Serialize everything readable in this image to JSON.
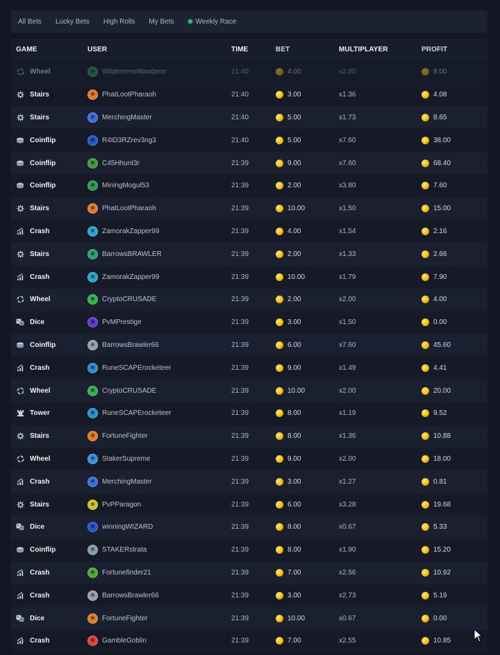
{
  "tabs": [
    {
      "label": "All Bets"
    },
    {
      "label": "Lucky Bets"
    },
    {
      "label": "High Rolls"
    },
    {
      "label": "My Bets"
    },
    {
      "label": "Weekly Race",
      "live": true
    }
  ],
  "columns": {
    "game": "GAME",
    "user": "USER",
    "time": "TIME",
    "bet": "BET",
    "multiplier": "MULTIPLAYER",
    "profit": "PROFIT"
  },
  "colors": {
    "background": "#121723",
    "coin": "#f2b705",
    "live_dot": "#27c270"
  },
  "rows": [
    {
      "game": "Wheel",
      "icon": "wheel-icon",
      "user": "WildernessWanderer",
      "avatar": "#2f9e6e",
      "time": "21:40",
      "bet": "4.00",
      "mult": "x2.00",
      "profit": "8.00",
      "faded": true
    },
    {
      "game": "Stairs",
      "icon": "stairs-icon",
      "user": "PhatLootPharaoh",
      "avatar": "#e07b2a",
      "time": "21:40",
      "bet": "3.00",
      "mult": "x1.36",
      "profit": "4.08"
    },
    {
      "game": "Stairs",
      "icon": "stairs-icon",
      "user": "MerchingMaster",
      "avatar": "#3a6fd8",
      "time": "21:40",
      "bet": "5.00",
      "mult": "x1.73",
      "profit": "8.65"
    },
    {
      "game": "Coinflip",
      "icon": "coinflip-icon",
      "user": "R4ID3RZrev3ng3",
      "avatar": "#2456c9",
      "time": "21:40",
      "bet": "5.00",
      "mult": "x7.60",
      "profit": "38.00"
    },
    {
      "game": "Coinflip",
      "icon": "coinflip-icon",
      "user": "C45Hhunt3r",
      "avatar": "#3d9a3a",
      "time": "21:39",
      "bet": "9.00",
      "mult": "x7.60",
      "profit": "68.40"
    },
    {
      "game": "Coinflip",
      "icon": "coinflip-icon",
      "user": "MiningMogul53",
      "avatar": "#2e9b55",
      "time": "21:39",
      "bet": "2.00",
      "mult": "x3.80",
      "profit": "7.60"
    },
    {
      "game": "Stairs",
      "icon": "stairs-icon",
      "user": "PhatLootPharaoh",
      "avatar": "#e07b2a",
      "time": "21:39",
      "bet": "10.00",
      "mult": "x1.50",
      "profit": "15.00"
    },
    {
      "game": "Crash",
      "icon": "crash-icon",
      "user": "ZamorakZapper99",
      "avatar": "#2aa5c9",
      "time": "21:39",
      "bet": "4.00",
      "mult": "x1.54",
      "profit": "2.16"
    },
    {
      "game": "Stairs",
      "icon": "stairs-icon",
      "user": "BarrowsBRAWLER",
      "avatar": "#2f9e6e",
      "time": "21:39",
      "bet": "2.00",
      "mult": "x1.33",
      "profit": "2.66"
    },
    {
      "game": "Crash",
      "icon": "crash-icon",
      "user": "ZamorakZapper99",
      "avatar": "#2aa5c9",
      "time": "21:39",
      "bet": "10.00",
      "mult": "x1.79",
      "profit": "7.90"
    },
    {
      "game": "Wheel",
      "icon": "wheel-icon",
      "user": "CryptoCRUSADE",
      "avatar": "#34b04a",
      "time": "21:39",
      "bet": "2.00",
      "mult": "x2.00",
      "profit": "4.00"
    },
    {
      "game": "Dice",
      "icon": "dice-icon",
      "user": "PvMPrestige",
      "avatar": "#5b3ad1",
      "time": "21:39",
      "bet": "3.00",
      "mult": "x1.50",
      "profit": "0.00"
    },
    {
      "game": "Coinflip",
      "icon": "coinflip-icon",
      "user": "BarrowsBrawler66",
      "avatar": "#9aa0ab",
      "time": "21:39",
      "bet": "6.00",
      "mult": "x7.60",
      "profit": "45.60"
    },
    {
      "game": "Crash",
      "icon": "crash-icon",
      "user": "RuneSCAPErocketeer",
      "avatar": "#2a8fc9",
      "time": "21:39",
      "bet": "9.00",
      "mult": "x1.49",
      "profit": "4.41"
    },
    {
      "game": "Wheel",
      "icon": "wheel-icon",
      "user": "CryptoCRUSADE",
      "avatar": "#34b04a",
      "time": "21:39",
      "bet": "10.00",
      "mult": "x2.00",
      "profit": "20.00"
    },
    {
      "game": "Tower",
      "icon": "tower-icon",
      "user": "RuneSCAPErocketeer",
      "avatar": "#2a8fc9",
      "time": "21:39",
      "bet": "8.00",
      "mult": "x1.19",
      "profit": "9.52"
    },
    {
      "game": "Stairs",
      "icon": "stairs-icon",
      "user": "FortuneFighter",
      "avatar": "#e07b2a",
      "time": "21:39",
      "bet": "8.00",
      "mult": "x1.36",
      "profit": "10.88"
    },
    {
      "game": "Wheel",
      "icon": "wheel-icon",
      "user": "StakerSupreme",
      "avatar": "#3a8fd8",
      "time": "21:39",
      "bet": "9.00",
      "mult": "x2.00",
      "profit": "18.00"
    },
    {
      "game": "Crash",
      "icon": "crash-icon",
      "user": "MerchingMaster",
      "avatar": "#3a6fd8",
      "time": "21:39",
      "bet": "3.00",
      "mult": "x1.27",
      "profit": "0.81"
    },
    {
      "game": "Stairs",
      "icon": "stairs-icon",
      "user": "PvPParagon",
      "avatar": "#c9c42a",
      "time": "21:39",
      "bet": "6.00",
      "mult": "x3.28",
      "profit": "19.68"
    },
    {
      "game": "Dice",
      "icon": "dice-icon",
      "user": "winningWIZARD",
      "avatar": "#2456c9",
      "time": "21:39",
      "bet": "8.00",
      "mult": "x0.67",
      "profit": "5.33"
    },
    {
      "game": "Coinflip",
      "icon": "coinflip-icon",
      "user": "STAKERstrata",
      "avatar": "#8a9aa8",
      "time": "21:39",
      "bet": "8.00",
      "mult": "x1.90",
      "profit": "15.20"
    },
    {
      "game": "Crash",
      "icon": "crash-icon",
      "user": "Fortunefinder21",
      "avatar": "#4aa83a",
      "time": "21:39",
      "bet": "7.00",
      "mult": "x2.56",
      "profit": "10.92"
    },
    {
      "game": "Crash",
      "icon": "crash-icon",
      "user": "BarrowsBrawler66",
      "avatar": "#9aa0ab",
      "time": "21:39",
      "bet": "3.00",
      "mult": "x2.73",
      "profit": "5.19"
    },
    {
      "game": "Dice",
      "icon": "dice-icon",
      "user": "FortuneFighter",
      "avatar": "#e07b2a",
      "time": "21:39",
      "bet": "10.00",
      "mult": "x0.67",
      "profit": "0.00"
    },
    {
      "game": "Crash",
      "icon": "crash-icon",
      "user": "GambleGoblin",
      "avatar": "#d8443a",
      "time": "21:39",
      "bet": "7.00",
      "mult": "x2.55",
      "profit": "10.85"
    }
  ]
}
